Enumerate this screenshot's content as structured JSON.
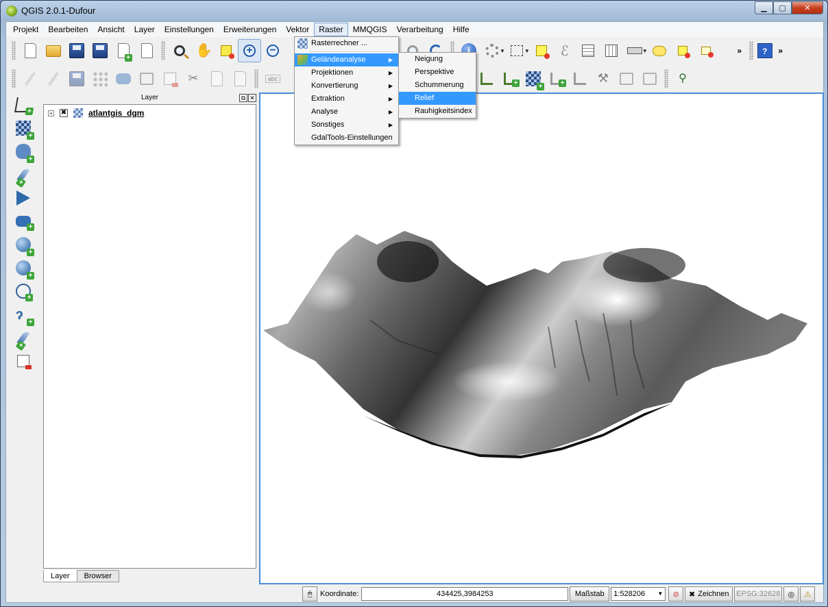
{
  "window": {
    "title": "QGIS 2.0.1-Dufour",
    "controls": [
      "minimize",
      "maximize",
      "close"
    ]
  },
  "menubar": {
    "items": [
      "Projekt",
      "Bearbeiten",
      "Ansicht",
      "Layer",
      "Einstellungen",
      "Erweiterungen",
      "Vektor",
      "Raster",
      "MMQGIS",
      "Verarbeitung",
      "Hilfe"
    ],
    "active": "Raster"
  },
  "raster_menu": {
    "items": [
      {
        "label": "Rasterrechner ...",
        "submenu": false
      },
      {
        "label": "Geländeanalyse",
        "submenu": true,
        "highlighted": true
      },
      {
        "label": "Projektionen",
        "submenu": true
      },
      {
        "label": "Konvertierung",
        "submenu": true
      },
      {
        "label": "Extraktion",
        "submenu": true
      },
      {
        "label": "Analyse",
        "submenu": true
      },
      {
        "label": "Sonstiges",
        "submenu": true
      },
      {
        "label": "GdalTools-Einstellungen",
        "submenu": false
      }
    ]
  },
  "terrain_submenu": {
    "items": [
      {
        "label": "Neigung"
      },
      {
        "label": "Perspektive"
      },
      {
        "label": "Schummerung"
      },
      {
        "label": "Relief",
        "highlighted": true
      },
      {
        "label": "Rauhigkeitsindex"
      }
    ]
  },
  "layers_panel": {
    "title": "Layer",
    "layers": [
      {
        "name": "atlantgis_dgm",
        "checked": true,
        "type": "raster"
      }
    ],
    "tabs": [
      "Layer",
      "Browser"
    ],
    "active_tab": "Layer"
  },
  "statusbar": {
    "coord_label": "Koordinate:",
    "coord_value": "434425,3984253",
    "scale_label": "Maßstab",
    "scale_value": "1:528206",
    "render_label": "Zeichnen",
    "render_checked": true,
    "crs": "EPSG:32628"
  },
  "colors": {
    "accent": "#3399ff",
    "map_border": "#4a8cd6",
    "titlebar": "#a9c0da"
  }
}
